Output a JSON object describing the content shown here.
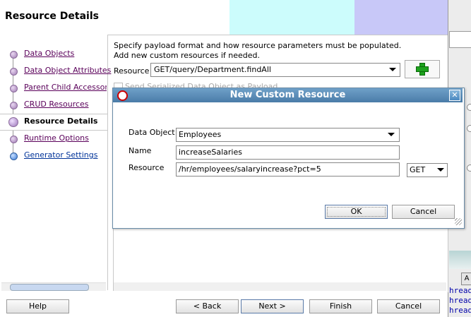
{
  "header": {
    "title": "Resource Details"
  },
  "nav": {
    "items": [
      {
        "label": "Data Objects"
      },
      {
        "label": "Data Object Attributes"
      },
      {
        "label": "Parent Child Accessors"
      },
      {
        "label": "CRUD Resources"
      },
      {
        "label": "Resource Details"
      },
      {
        "label": "Runtime Options"
      },
      {
        "label": "Generator Settings"
      }
    ]
  },
  "main": {
    "instruction": "Specify payload format and how resource parameters must be populated. Add new custom resources if needed.",
    "resource_label": "Resource",
    "resource_value": "GET/query/Department.findAll",
    "add_icon": "plus-icon",
    "checkbox_label": "Send Serialized Data Object as Payload"
  },
  "dialog": {
    "title": "New Custom Resource",
    "data_object_label": "Data Object",
    "data_object_value": "Employees",
    "name_label": "Name",
    "name_value": "increaseSalaries",
    "resource_label": "Resource",
    "resource_value": "/hr/employees/salaryincrease?pct=5",
    "method_value": "GET",
    "ok_label": "OK",
    "cancel_label": "Cancel",
    "close_icon": "close-icon"
  },
  "footer": {
    "help_label": "Help",
    "back_label": "< Back",
    "next_label": "Next >",
    "finish_label": "Finish",
    "cancel_label": "Cancel"
  },
  "background_window": {
    "button_label": "A",
    "lines": [
      "hread",
      "hread",
      "hread"
    ]
  },
  "colors": {
    "title_bar": "#4a7ca8",
    "header_band_cyan": "#ccfcfc",
    "header_band_lavender": "#c8c8f8",
    "nav_link": "#5a005a",
    "add_icon_green": "#1ea21e"
  }
}
